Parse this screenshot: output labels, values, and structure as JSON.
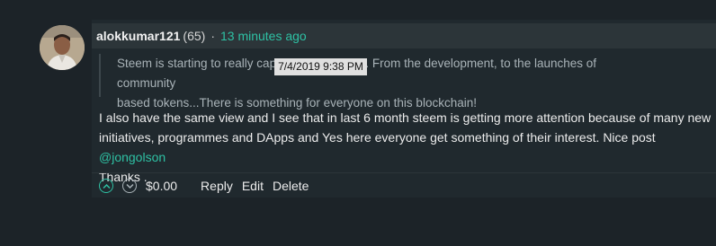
{
  "comment": {
    "author": "alokkumar121",
    "reputation": "(65)",
    "separator": "·",
    "timestamp": "13 minutes ago",
    "tooltip": "7/4/2019 9:38 PM",
    "quote_line1_a": "Steem is starting to really cap",
    "quote_line1_b": "ntion. From the development, to the launches of community",
    "quote_line2": "based tokens...There is something for everyone on this blockchain!",
    "body_line1": "I also have the same view and I see that in last 6 month steem is getting more attention because of many new",
    "body_line2_a": "initiatives, programmes and DApps and Yes here everyone get something of their interest. Nice post ",
    "mention": "@jongolson",
    "body_line3": "Thanks .",
    "payout": "$0.00",
    "actions": {
      "reply": "Reply",
      "edit": "Edit",
      "delete": "Delete"
    }
  },
  "colors": {
    "accent": "#2ec1a4",
    "background": "#1c2328",
    "header": "#2c3539"
  },
  "icons": [
    "avatar",
    "upvote-icon",
    "downvote-icon"
  ]
}
